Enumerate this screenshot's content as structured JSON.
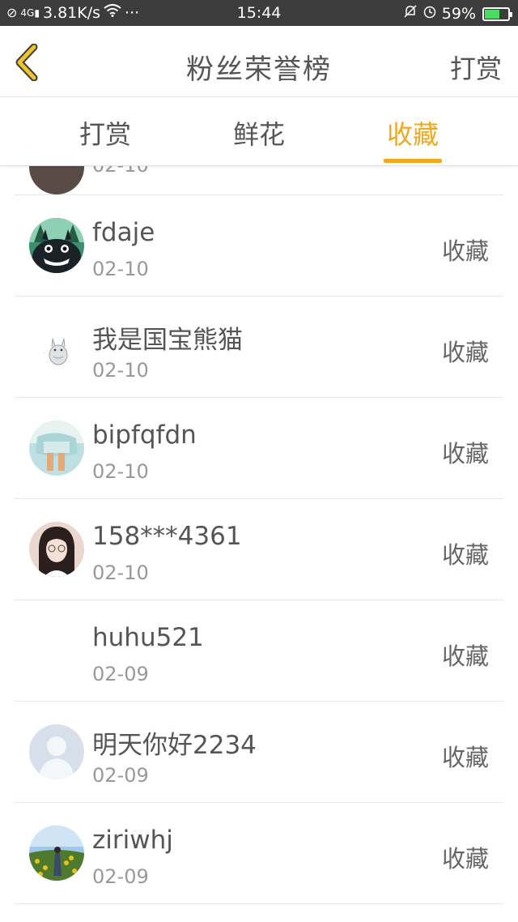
{
  "status_bar": {
    "network_speed": "3.81K/s",
    "network_type": "4G",
    "more": "···",
    "time": "15:44",
    "battery_percent": "59%",
    "battery_level": 0.59,
    "icons": [
      "no-sim-icon",
      "signal-icon",
      "wifi-icon",
      "silent-bell-icon",
      "alarm-icon",
      "battery-icon"
    ]
  },
  "header": {
    "title": "粉丝荣誉榜",
    "action_label": "打赏",
    "back_icon": "chevron-left-icon"
  },
  "tabs": [
    {
      "label": "打赏",
      "active": false
    },
    {
      "label": "鲜花",
      "active": false
    },
    {
      "label": "收藏",
      "active": true
    }
  ],
  "colors": {
    "accent": "#f2a81c",
    "status_bar_bg": "#3c3c3c",
    "text": "#555555",
    "muted": "#999999"
  },
  "list": {
    "partial_row_date": "02-10",
    "rows": [
      {
        "name": "fdaje",
        "date": "02-10",
        "action": "收藏",
        "avatar": "totoro-avatar"
      },
      {
        "name": "我是国宝熊猫",
        "date": "02-10",
        "action": "收藏",
        "avatar": "totoro-sketch-avatar"
      },
      {
        "name": "bipfqfdn",
        "date": "02-10",
        "action": "收藏",
        "avatar": "photo-avatar"
      },
      {
        "name": "158***4361",
        "date": "02-10",
        "action": "收藏",
        "avatar": "girl-photo-avatar"
      },
      {
        "name": "huhu521",
        "date": "02-09",
        "action": "收藏",
        "avatar": "blank-avatar"
      },
      {
        "name": "明天你好2234",
        "date": "02-09",
        "action": "收藏",
        "avatar": "default-user-avatar"
      },
      {
        "name": "ziriwhj",
        "date": "02-09",
        "action": "收藏",
        "avatar": "flower-field-avatar"
      }
    ]
  }
}
